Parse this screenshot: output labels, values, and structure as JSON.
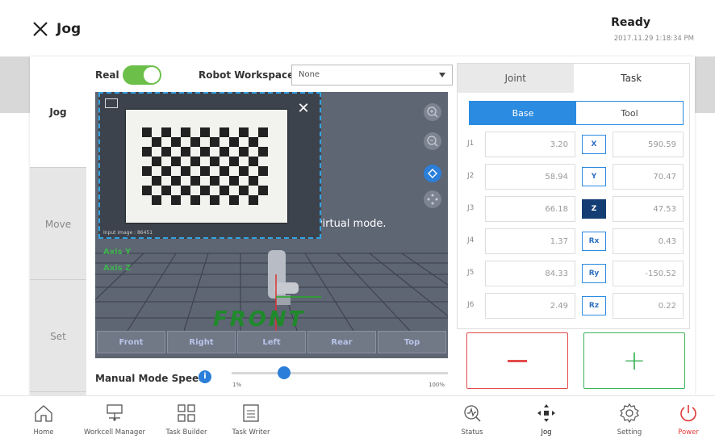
{
  "header": {
    "title": "Jog",
    "status": "Ready",
    "timestamp": "2017.11.29 1:18:34 PM"
  },
  "tabs": [
    {
      "label": "Jog",
      "active": true
    },
    {
      "label": "Move",
      "active": false
    },
    {
      "label": "Set",
      "active": false
    }
  ],
  "controls": {
    "real_label": "Real",
    "real_on": true,
    "workspace_label": "Robot Workspace",
    "workspace_value": "None"
  },
  "viewport": {
    "message": "n the virtual mode.",
    "axis_y": "Axis Y",
    "axis_z": "Axis Z",
    "front_text": "FRONT",
    "camera_caption": "Input image : 86451",
    "view_buttons": [
      "Front",
      "Right",
      "Left",
      "Rear",
      "Top"
    ]
  },
  "speed": {
    "label": "Manual Mode Speed",
    "min": "1%",
    "max": "100%",
    "value_fraction": 0.22
  },
  "right_panel": {
    "tabs": [
      "Joint",
      "Task"
    ],
    "active_tab": "Task",
    "frames": [
      "Base",
      "Tool"
    ],
    "active_frame": "Base",
    "joints": [
      {
        "label": "J1",
        "value": "3.20"
      },
      {
        "label": "J2",
        "value": "58.94"
      },
      {
        "label": "J3",
        "value": "66.18"
      },
      {
        "label": "J4",
        "value": "1.37"
      },
      {
        "label": "J5",
        "value": "84.33"
      },
      {
        "label": "J6",
        "value": "2.49"
      }
    ],
    "task": [
      {
        "label": "X",
        "value": "590.59",
        "selected": false
      },
      {
        "label": "Y",
        "value": "70.47",
        "selected": false
      },
      {
        "label": "Z",
        "value": "47.53",
        "selected": true
      },
      {
        "label": "Rx",
        "value": "0.43",
        "selected": false
      },
      {
        "label": "Ry",
        "value": "-150.52",
        "selected": false
      },
      {
        "label": "Rz",
        "value": "0.22",
        "selected": false
      }
    ]
  },
  "nav": [
    {
      "label": "Home",
      "icon": "home-icon"
    },
    {
      "label": "Workcell Manager",
      "icon": "workcell-icon"
    },
    {
      "label": "Task Builder",
      "icon": "task-builder-icon"
    },
    {
      "label": "Task Writer",
      "icon": "task-writer-icon"
    },
    {
      "label": "Status",
      "icon": "status-icon"
    },
    {
      "label": "Jog",
      "icon": "jog-icon"
    },
    {
      "label": "Setting",
      "icon": "gear-icon"
    },
    {
      "label": "Power",
      "icon": "power-icon"
    }
  ],
  "colors": {
    "accent": "#2b8be0",
    "toggle_on": "#6cc04a",
    "minus": "#e34b4b",
    "plus": "#3bb35a",
    "power": "#e03a3a"
  }
}
